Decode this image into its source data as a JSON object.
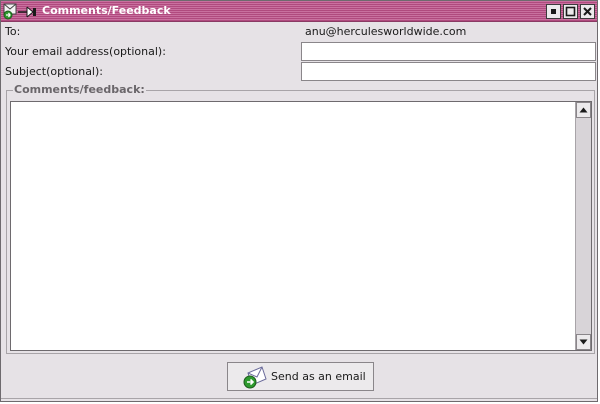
{
  "window": {
    "title": "Comments/Feedback",
    "icons": {
      "app": "app-icon",
      "minimize": "minimize-icon",
      "maximize": "maximize-icon",
      "close": "close-icon"
    }
  },
  "form": {
    "to_label": "To:",
    "to_value": "anu@herculesworldwide.com",
    "email_label": "Your email address(optional):",
    "email_value": "",
    "subject_label": "Subject(optional):",
    "subject_value": "",
    "comments_legend": "Comments/feedback:",
    "comments_value": ""
  },
  "actions": {
    "send_label": "Send as an email",
    "send_icon": "envelope-send-icon"
  },
  "colors": {
    "titlebar": "#b04a7e",
    "window_bg": "#e6e2e6",
    "field_bg": "#ffffff",
    "legend_text": "#6a666a"
  }
}
